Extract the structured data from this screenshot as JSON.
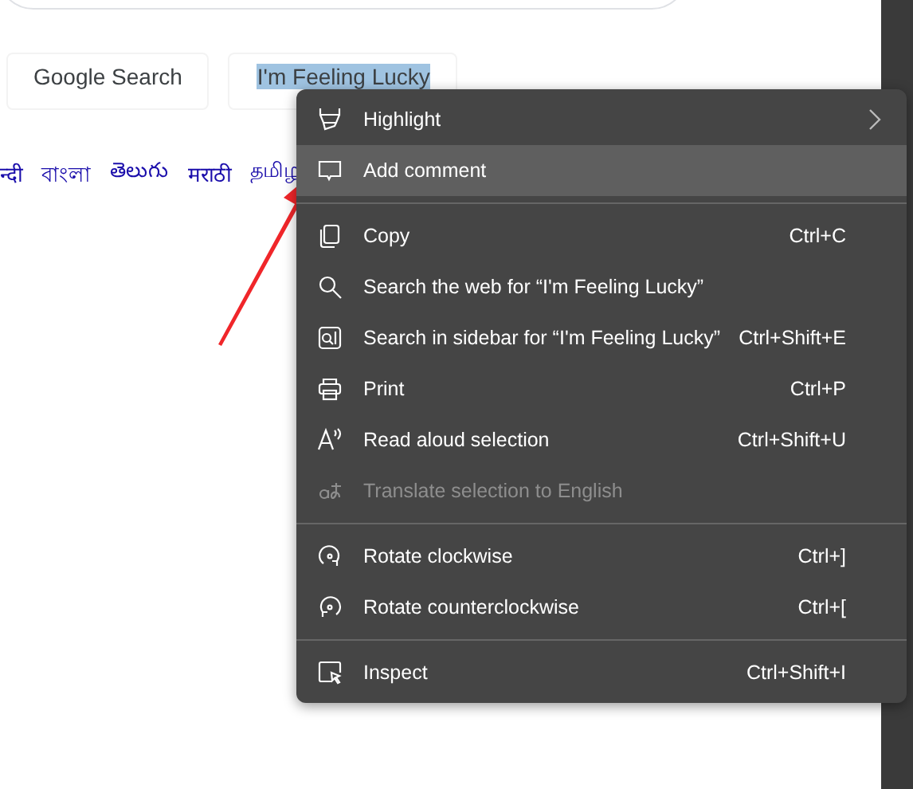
{
  "buttons": [
    {
      "label": "Google Search",
      "text_selected": false
    },
    {
      "label": "I'm Feeling Lucky",
      "text_selected": true
    }
  ],
  "language_links": [
    "न्दी",
    "বাংলা",
    "తెలుగు",
    "मराठी",
    "தமிழ"
  ],
  "context_menu": {
    "items": [
      {
        "kind": "item",
        "label": "Highlight",
        "submenu": true,
        "selected": false,
        "disabled": false
      },
      {
        "kind": "item",
        "label": "Add comment",
        "submenu": false,
        "selected": true,
        "disabled": false
      },
      {
        "kind": "separator"
      },
      {
        "kind": "item",
        "label": "Copy",
        "shortcut": "Ctrl+C",
        "submenu": false,
        "selected": false,
        "disabled": false
      },
      {
        "kind": "item",
        "label": "Search the web for “I'm Feeling Lucky”",
        "submenu": false,
        "selected": false,
        "disabled": false
      },
      {
        "kind": "item",
        "label": "Search in sidebar for “I'm Feeling Lucky”",
        "shortcut": "Ctrl+Shift+E",
        "submenu": false,
        "selected": false,
        "disabled": false
      },
      {
        "kind": "item",
        "label": "Print",
        "shortcut": "Ctrl+P",
        "submenu": false,
        "selected": false,
        "disabled": false
      },
      {
        "kind": "item",
        "label": "Read aloud selection",
        "shortcut": "Ctrl+Shift+U",
        "submenu": false,
        "selected": false,
        "disabled": false
      },
      {
        "kind": "item",
        "label": "Translate selection to English",
        "submenu": false,
        "selected": false,
        "disabled": true
      },
      {
        "kind": "separator"
      },
      {
        "kind": "item",
        "label": "Rotate clockwise",
        "shortcut": "Ctrl+]",
        "submenu": false,
        "selected": false,
        "disabled": false
      },
      {
        "kind": "item",
        "label": "Rotate counterclockwise",
        "shortcut": "Ctrl+[",
        "submenu": false,
        "selected": false,
        "disabled": false
      },
      {
        "kind": "separator"
      },
      {
        "kind": "item",
        "label": "Inspect",
        "shortcut": "Ctrl+Shift+I",
        "submenu": false,
        "selected": false,
        "disabled": false
      }
    ]
  }
}
